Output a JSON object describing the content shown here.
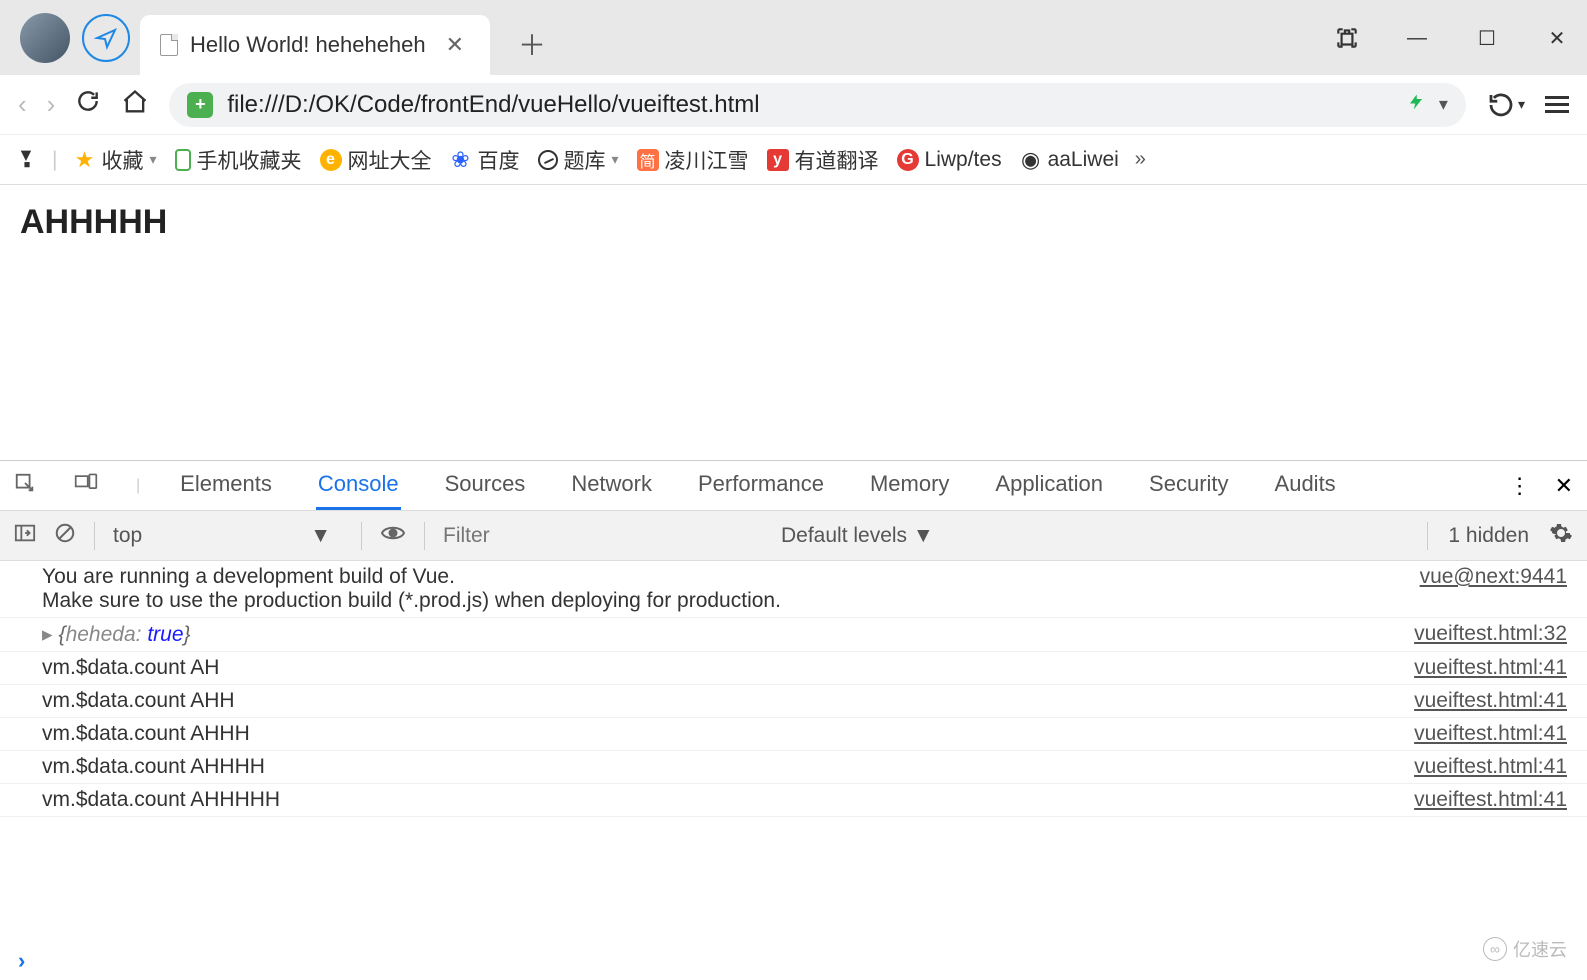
{
  "window": {
    "tab_title": "Hello World! heheheheh",
    "new_tab_glyph": "＋",
    "controls": {
      "extension": "⌕",
      "minimize": "—",
      "maximize": "☐",
      "close": "✕"
    },
    "shirt_glyph": "👕"
  },
  "navbar": {
    "url": "file:///D:/OK/Code/frontEnd/vueHello/vueiftest.html",
    "bolt": "⚡",
    "reload": "↻",
    "back": "‹",
    "forward": "›"
  },
  "bookmarks": {
    "items": [
      {
        "label": "收藏",
        "icon": "star"
      },
      {
        "label": "手机收藏夹",
        "icon": "phone"
      },
      {
        "label": "网址大全",
        "icon": "360"
      },
      {
        "label": "百度",
        "icon": "baidu"
      },
      {
        "label": "题库",
        "icon": "tiku"
      },
      {
        "label": "凌川江雪",
        "icon": "jian"
      },
      {
        "label": "有道翻译",
        "icon": "yd"
      },
      {
        "label": "Liwp/tes",
        "icon": "g"
      },
      {
        "label": "aaLiwei",
        "icon": "gh"
      }
    ],
    "more": "»"
  },
  "page": {
    "heading": "AHHHHH"
  },
  "devtools": {
    "tabs": [
      "Elements",
      "Console",
      "Sources",
      "Network",
      "Performance",
      "Memory",
      "Application",
      "Security",
      "Audits"
    ],
    "active_tab": "Console",
    "toolbar": {
      "context": "top",
      "filter_placeholder": "Filter",
      "levels": "Default levels ▼",
      "hidden": "1 hidden"
    },
    "console_rows": [
      {
        "type": "text",
        "msg": "You are running a development build of Vue.\nMake sure to use the production build (*.prod.js) when deploying for production.",
        "src": "vue@next:9441"
      },
      {
        "type": "object",
        "key": "heheda",
        "val": "true",
        "src": "vueiftest.html:32"
      },
      {
        "type": "text",
        "msg": "vm.$data.count AH",
        "src": "vueiftest.html:41"
      },
      {
        "type": "text",
        "msg": "vm.$data.count AHH",
        "src": "vueiftest.html:41"
      },
      {
        "type": "text",
        "msg": "vm.$data.count AHHH",
        "src": "vueiftest.html:41"
      },
      {
        "type": "text",
        "msg": "vm.$data.count AHHHH",
        "src": "vueiftest.html:41"
      },
      {
        "type": "text",
        "msg": "vm.$data.count AHHHHH",
        "src": "vueiftest.html:41"
      }
    ],
    "prompt": "›"
  },
  "watermark": "亿速云"
}
